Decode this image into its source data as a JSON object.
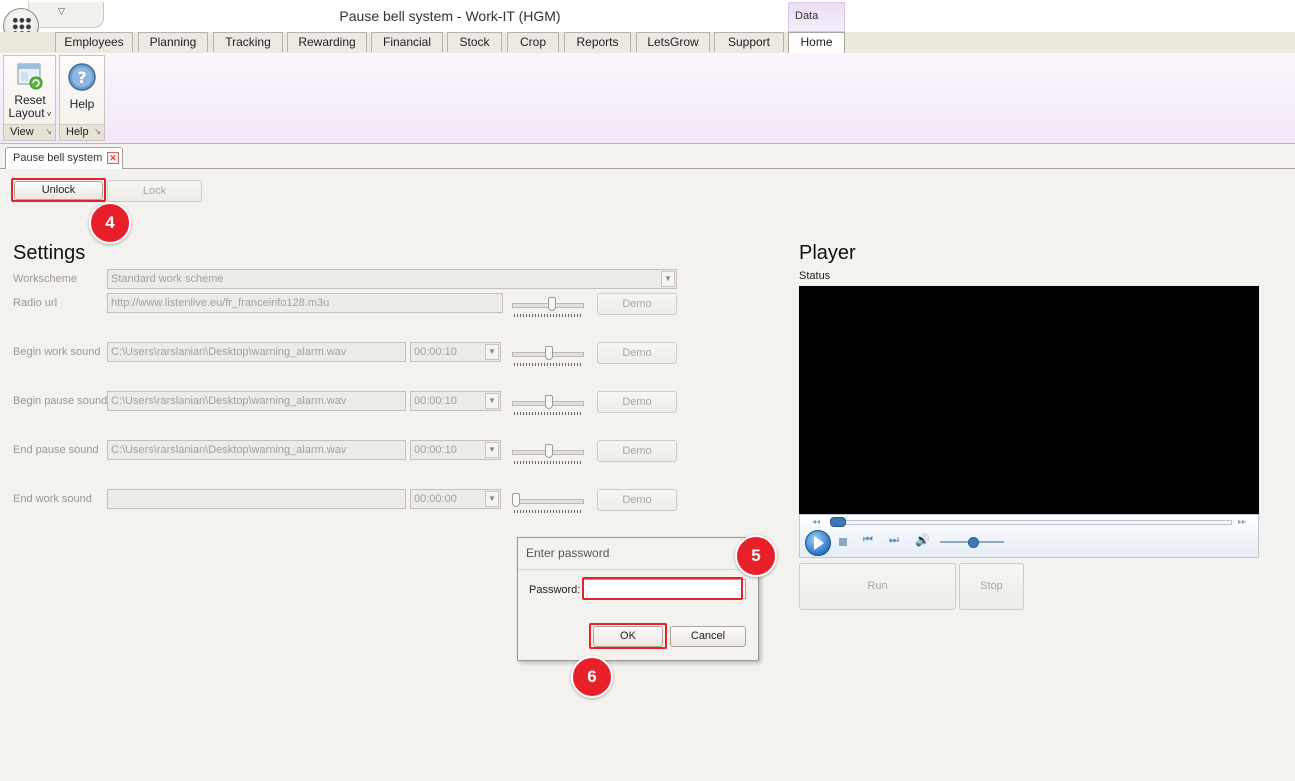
{
  "window": {
    "title": "Pause bell system - Work-IT (HGM)",
    "context_tab_group": "Data"
  },
  "ribbon_tabs": [
    "Employees",
    "Planning",
    "Tracking",
    "Rewarding",
    "Financial",
    "Stock",
    "Crop",
    "Reports",
    "LetsGrow",
    "Support",
    "Home"
  ],
  "active_tab": "Home",
  "ribbon": {
    "groups": [
      {
        "name": "View",
        "buttons": [
          {
            "label_line1": "Reset",
            "label_line2": "Layout",
            "icon": "window-refresh-icon"
          }
        ]
      },
      {
        "name": "Help",
        "buttons": [
          {
            "label": "Help",
            "icon": "help-question-icon"
          }
        ]
      }
    ]
  },
  "document_tab": {
    "label": "Pause bell system"
  },
  "toolbar": {
    "unlock_label": "Unlock",
    "lock_label": "Lock"
  },
  "settings": {
    "heading": "Settings",
    "workscheme": {
      "label": "Workscheme",
      "value": "Standard work scheme"
    },
    "radio_url": {
      "label": "Radio url",
      "value": "http://www.listenlive.eu/fr_franceinfo128.m3u",
      "volume": 0.55,
      "demo_label": "Demo"
    },
    "sounds": [
      {
        "label": "Begin work sound",
        "path": "C:\\Users\\rarslanian\\Desktop\\warning_alarm.wav",
        "time": "00:00:10",
        "volume": 0.5,
        "demo_label": "Demo"
      },
      {
        "label": "Begin pause sound",
        "path": "C:\\Users\\rarslanian\\Desktop\\warning_alarm.wav",
        "time": "00:00:10",
        "volume": 0.5,
        "demo_label": "Demo"
      },
      {
        "label": "End pause sound",
        "path": "C:\\Users\\rarslanian\\Desktop\\warning_alarm.wav",
        "time": "00:00:10",
        "volume": 0.5,
        "demo_label": "Demo"
      },
      {
        "label": "End work sound",
        "path": "",
        "time": "00:00:00",
        "volume": 0.0,
        "demo_label": "Demo"
      }
    ]
  },
  "player": {
    "heading": "Player",
    "status_label": "Status",
    "run_label": "Run",
    "stop_label": "Stop"
  },
  "dialog": {
    "title": "Enter password",
    "password_label": "Password:",
    "password_value": "",
    "ok_label": "OK",
    "cancel_label": "Cancel"
  },
  "annotations": {
    "step_unlock": "4",
    "step_password": "5",
    "step_ok": "6",
    "highlight_color": "#e8202a"
  }
}
